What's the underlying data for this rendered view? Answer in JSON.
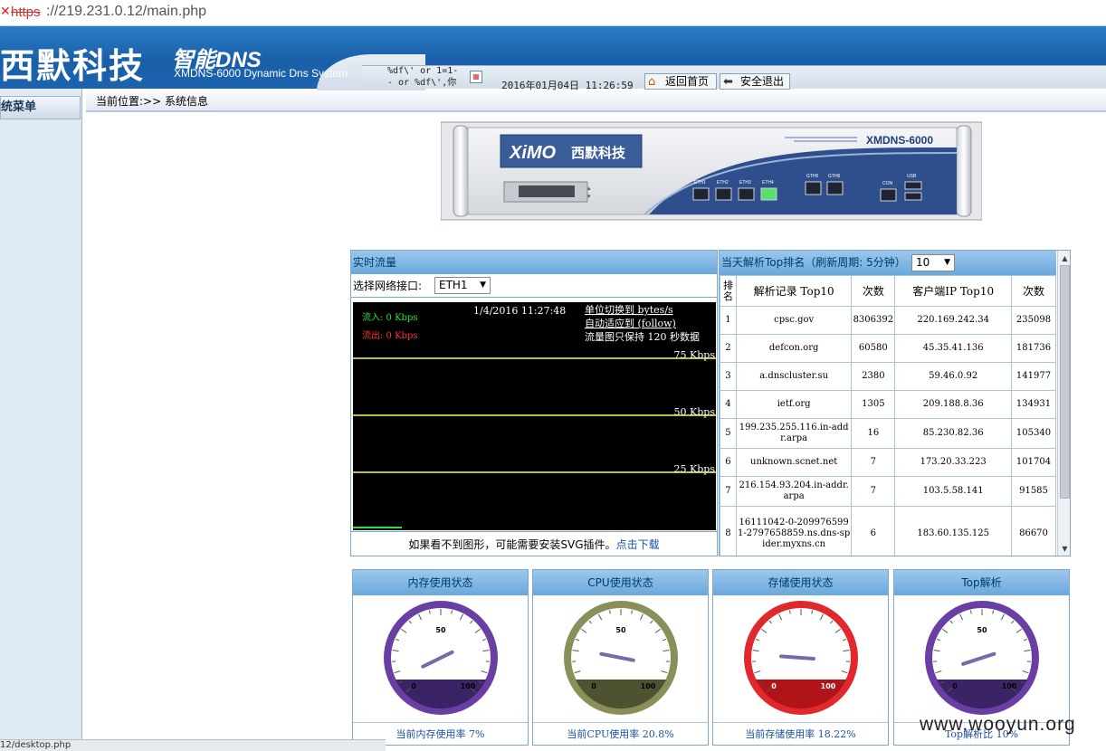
{
  "urlbar": {
    "scheme": "https",
    "host": "://219.231.0.12/main.php"
  },
  "header": {
    "logo": "西默科技",
    "logo_brand": "智能DNS",
    "logo_sub": "XMDNS-6000 Dynamic Dns System",
    "injected_text": "%df\\' or 1=1-- or %df\\',你",
    "datetime": "2016年01月04日 11:26:59",
    "home_label": "返回首页",
    "logout_label": "安全退出"
  },
  "sidebar": {
    "title": "系统菜单"
  },
  "breadcrumb": {
    "text": "当前位置:>> 系统信息"
  },
  "device": {
    "brand_en": "XiMO",
    "brand_cn": "西默科技",
    "model": "XMDNS-6000",
    "ports": [
      "ETH1",
      "ETH2",
      "ETH3",
      "ETH4"
    ],
    "ports2": [
      "GTH5",
      "GTH6"
    ],
    "con": "CON",
    "usb": "USB"
  },
  "traffic": {
    "title": "实时流量",
    "iface_label": "选择网络接口:",
    "iface_value": "ETH1",
    "in_label": "流入: 0 Kbps",
    "out_label": "流出: 0 Kbps",
    "timestamp": "1/4/2016 11:27:48",
    "unit_text": "单位切换到 bytes/s",
    "adapt_text": "自动适应到 (follow)",
    "keep_text": "流量图只保持 120 秒数据",
    "gridlines": [
      "75 Kbps",
      "50 Kbps",
      "25 Kbps"
    ],
    "footer_text": "如果看不到图形，可能需要安装SVG插件。",
    "footer_link": "点击下载"
  },
  "top": {
    "title": "当天解析Top排名（刷新周期: 5分钟）",
    "select_value": "10",
    "headers": [
      "排名",
      "解析记录 Top10",
      "次数",
      "客户端IP Top10",
      "次数"
    ],
    "rows": [
      [
        "1",
        "cpsc.gov",
        "8306392",
        "220.169.242.34",
        "235098"
      ],
      [
        "2",
        "defcon.org",
        "60580",
        "45.35.41.136",
        "181736"
      ],
      [
        "3",
        "a.dnscluster.su",
        "2380",
        "59.46.0.92",
        "141977"
      ],
      [
        "4",
        "ietf.org",
        "1305",
        "209.188.8.36",
        "134931"
      ],
      [
        "5",
        "199.235.255.116.in-addr.arpa",
        "16",
        "85.230.82.36",
        "105340"
      ],
      [
        "6",
        "unknown.scnet.net",
        "7",
        "173.20.33.223",
        "101704"
      ],
      [
        "7",
        "216.154.93.204.in-addr.arpa",
        "7",
        "103.5.58.141",
        "91585"
      ],
      [
        "8",
        "16111042-0-2099765991-2797658859.ns.dns-spider.myxns.cn",
        "6",
        "183.60.135.125",
        "86670"
      ]
    ]
  },
  "gauges": [
    {
      "title": "内存使用状态",
      "footer": "当前内存使用率 7%",
      "value": 7,
      "color": "#6a3fa3",
      "dark": "#3a2466",
      "labels": [
        "0",
        "50",
        "100"
      ]
    },
    {
      "title": "CPU使用状态",
      "footer": "当前CPU使用率 20.8%",
      "value": 20.8,
      "color": "#8a8f5a",
      "dark": "#4e5230",
      "labels": [
        "0",
        "50",
        "100"
      ]
    },
    {
      "title": "存储使用状态",
      "footer": "当前存储使用率 18.22%",
      "value": 18.22,
      "color": "#e0282d",
      "dark": "#b01418",
      "labels": [
        "0",
        "50",
        "100"
      ]
    },
    {
      "title": "Top解析",
      "footer": "Top解析比 10%",
      "value": 10,
      "color": "#6a3fa3",
      "dark": "#3a2466",
      "labels": [
        "0",
        "50",
        "100"
      ]
    }
  ],
  "watermark": "www.wooyun.org",
  "statusbar": "12/desktop.php"
}
